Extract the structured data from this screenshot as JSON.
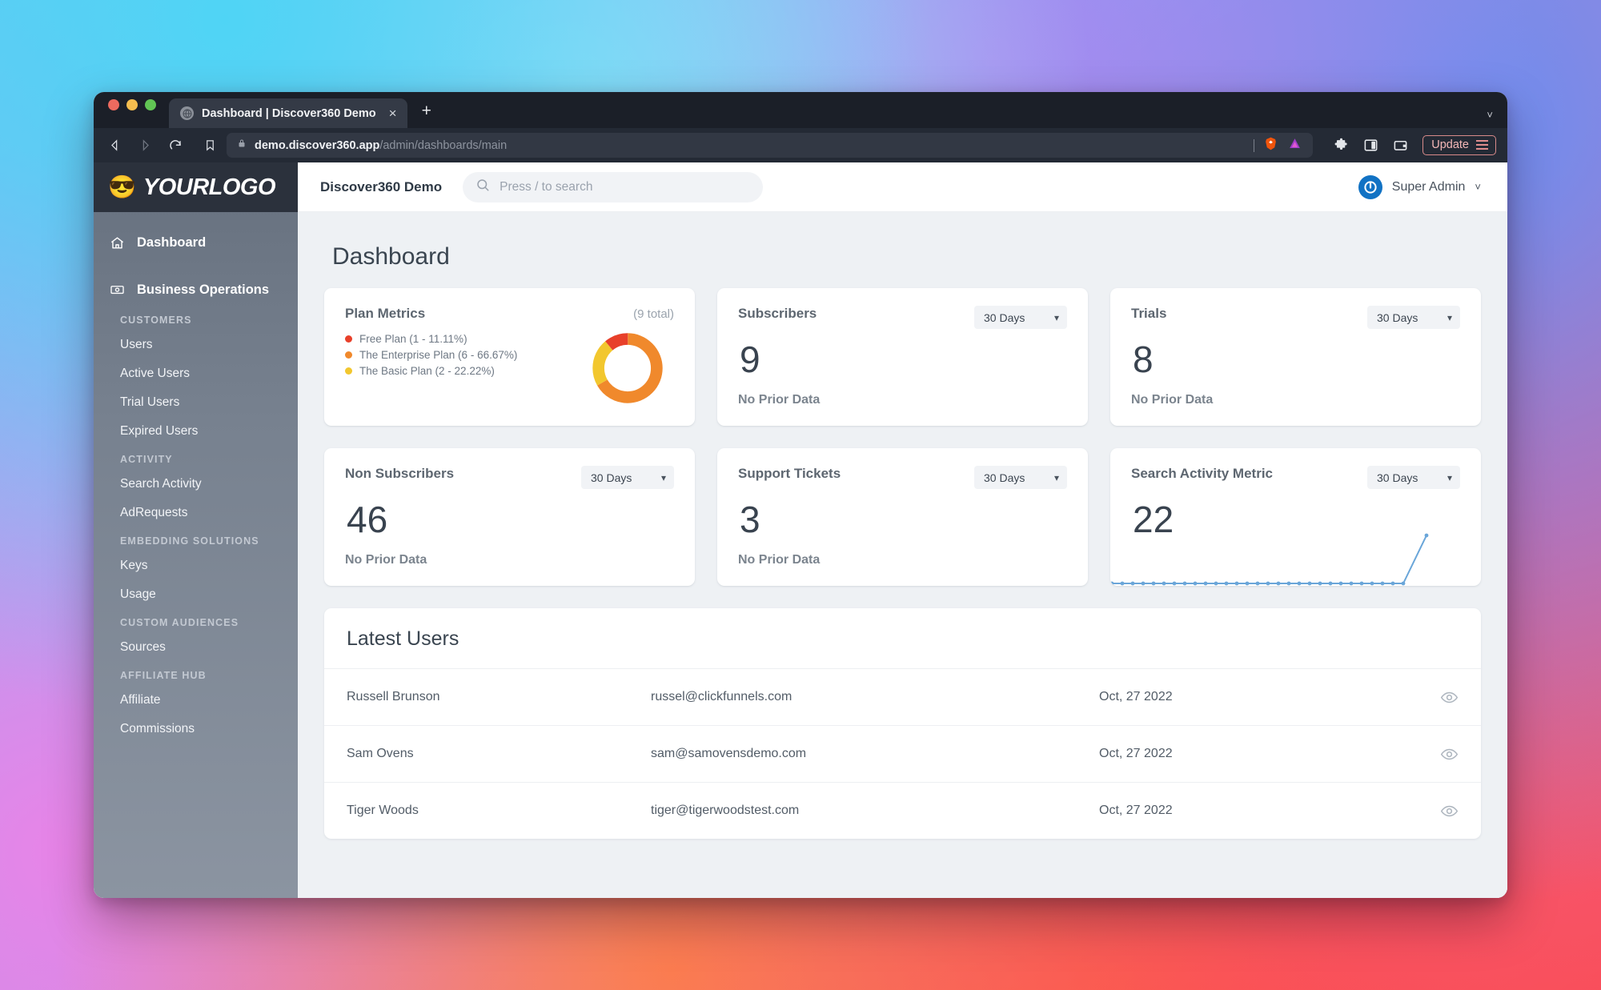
{
  "browser": {
    "tab": {
      "title": "Dashboard | Discover360 Demo",
      "favicon": "globe-icon",
      "close": "×"
    },
    "new_tab": "+",
    "tab_list_chevron": "˅",
    "nav": {
      "back": "◁",
      "forward": "▷",
      "reload": "↻"
    },
    "url": {
      "domain": "demo.discover360.app",
      "path": "/admin/dashboards/main",
      "lock": "lock-icon"
    },
    "shields": [
      "brave-lion-icon",
      "brave-rewards-triangle-icon"
    ],
    "toolbar_icons": [
      "extensions-puzzle-icon",
      "sidebar-panel-icon",
      "wallet-icon"
    ],
    "update_label": "Update"
  },
  "sidebar": {
    "logo": {
      "emoji": "😎",
      "text": "YOURLOGO"
    },
    "primary": [
      {
        "label": "Dashboard",
        "icon": "home-icon"
      },
      {
        "label": "Business Operations",
        "icon": "money-icon"
      }
    ],
    "groups": [
      {
        "title": "CUSTOMERS",
        "items": [
          "Users",
          "Active Users",
          "Trial Users",
          "Expired Users"
        ]
      },
      {
        "title": "ACTIVITY",
        "items": [
          "Search Activity",
          "AdRequests"
        ]
      },
      {
        "title": "EMBEDDING SOLUTIONS",
        "items": [
          "Keys",
          "Usage"
        ]
      },
      {
        "title": "CUSTOM AUDIENCES",
        "items": [
          "Sources"
        ]
      },
      {
        "title": "AFFILIATE HUB",
        "items": [
          "Affiliate",
          "Commissions"
        ]
      }
    ]
  },
  "header": {
    "app_title": "Discover360 Demo",
    "search_placeholder": "Press / to search",
    "search_value": "",
    "user_name": "Super Admin",
    "user_chevron": "˅",
    "avatar": "power-logo-avatar"
  },
  "main": {
    "page_title": "Dashboard",
    "cards": [
      {
        "id": "plan-metrics",
        "title": "Plan Metrics",
        "total_label": "(9 total)",
        "legend": [
          {
            "label": "Free Plan (1 - 11.11%)",
            "color": "#e8402a"
          },
          {
            "label": "The Enterprise Plan (6 - 66.67%)",
            "color": "#f0892c"
          },
          {
            "label": "The Basic Plan (2 - 22.22%)",
            "color": "#f2c72e"
          }
        ]
      },
      {
        "id": "subscribers",
        "title": "Subscribers",
        "period": "30 Days",
        "value": "9",
        "subtext": "No Prior Data"
      },
      {
        "id": "trials",
        "title": "Trials",
        "period": "30 Days",
        "value": "8",
        "subtext": "No Prior Data"
      },
      {
        "id": "non-subscribers",
        "title": "Non Subscribers",
        "period": "30 Days",
        "value": "46",
        "subtext": "No Prior Data"
      },
      {
        "id": "support-tickets",
        "title": "Support Tickets",
        "period": "30 Days",
        "value": "3",
        "subtext": "No Prior Data"
      },
      {
        "id": "search-activity-metric",
        "title": "Search Activity Metric",
        "period": "30 Days",
        "value": "22",
        "subtext": ""
      }
    ],
    "latest_users": {
      "title": "Latest Users",
      "rows": [
        {
          "name": "Russell Brunson",
          "email": "russel@clickfunnels.com",
          "date": "Oct, 27 2022",
          "action": "eye-icon"
        },
        {
          "name": "Sam Ovens",
          "email": "sam@samovensdemo.com",
          "date": "Oct, 27 2022",
          "action": "eye-icon"
        },
        {
          "name": "Tiger Woods",
          "email": "tiger@tigerwoodstest.com",
          "date": "Oct, 27 2022",
          "action": "eye-icon"
        }
      ]
    }
  },
  "chart_data": [
    {
      "type": "pie",
      "id": "plan-metrics-donut",
      "title": "Plan Metrics",
      "total": 9,
      "labels": [
        "The Enterprise Plan",
        "The Basic Plan",
        "Free Plan"
      ],
      "values": [
        6,
        2,
        1
      ],
      "percents": [
        66.67,
        22.22,
        11.11
      ],
      "colors": [
        "#f0892c",
        "#f2c72e",
        "#e8402a"
      ],
      "donut": true,
      "legend_position": "left",
      "start_angle": 0
    },
    {
      "type": "line",
      "id": "search-activity-sparkline",
      "title": "Search Activity Metric",
      "xlabel": "",
      "ylabel": "",
      "x": [
        1,
        2,
        3,
        4,
        5,
        6,
        7,
        8,
        9,
        10,
        11,
        12,
        13,
        14,
        15,
        16,
        17,
        18,
        19,
        20,
        21,
        22,
        23,
        24,
        25,
        26,
        27,
        28,
        29,
        30
      ],
      "values": [
        0,
        0,
        0,
        0,
        0,
        0,
        0,
        0,
        0,
        0,
        0,
        0,
        0,
        0,
        0,
        0,
        0,
        0,
        0,
        0,
        0,
        0,
        0,
        0,
        0,
        0,
        0,
        0,
        0,
        22
      ],
      "ylim": [
        0,
        22
      ],
      "grid": false,
      "color": "#6aa6d9",
      "markers": true
    }
  ]
}
